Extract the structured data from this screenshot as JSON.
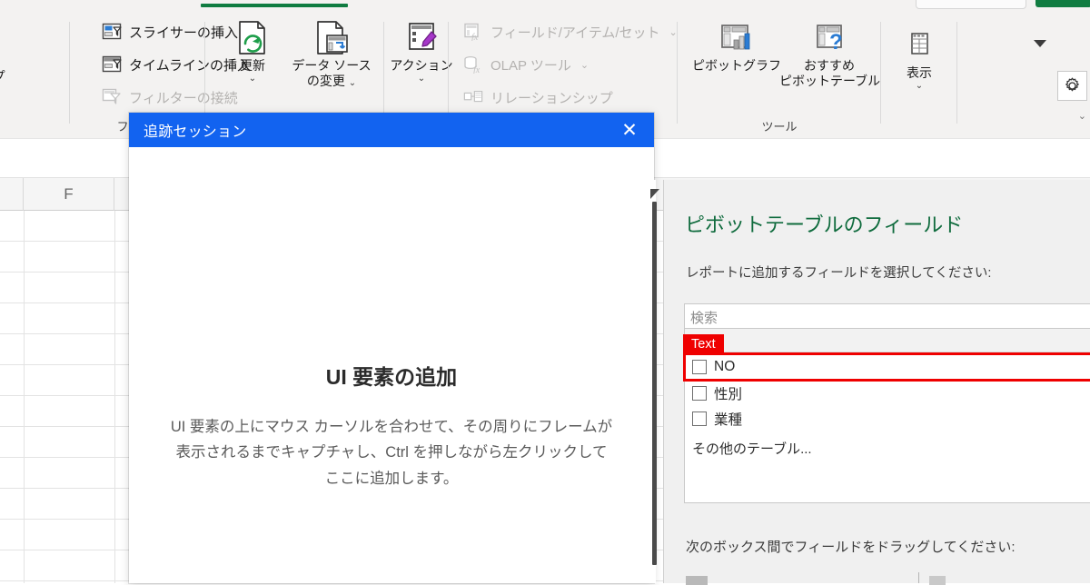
{
  "ribbon": {
    "groups": [
      {
        "label": "",
        "name": "group-partial"
      },
      {
        "label": "フィルター",
        "name": "group-filter"
      },
      {
        "label": "",
        "name": "group-data"
      },
      {
        "label": "",
        "name": "group-calculations"
      },
      {
        "label": "ツール",
        "name": "group-tools"
      },
      {
        "label": "",
        "name": "group-show"
      }
    ],
    "left_partial": {
      "caption": "ープ",
      "chevron": "⌄"
    },
    "filter_items": [
      {
        "label": "スライサーの挿入",
        "icon": "insert-slicer-icon",
        "disabled": false
      },
      {
        "label": "タイムラインの挿入",
        "icon": "insert-timeline-icon",
        "disabled": false
      },
      {
        "label": "フィルターの接続",
        "icon": "filter-connections-icon",
        "disabled": true
      }
    ],
    "refresh_button": {
      "label": "更新",
      "chevron": "⌄",
      "icon": "refresh-icon"
    },
    "change_source_button": {
      "label_line1": "データ ソース",
      "label_line2": "の変更",
      "chevron": "⌄",
      "icon": "change-data-source-icon"
    },
    "actions_button": {
      "label": "アクション",
      "chevron": "⌄",
      "icon": "actions-icon"
    },
    "calc_items": [
      {
        "label": "フィールド/アイテム/セット",
        "icon": "fields-items-sets-icon",
        "dropdown": "⌄",
        "disabled": true
      },
      {
        "label": "OLAP ツール",
        "icon": "olap-tools-icon",
        "dropdown": "⌄",
        "disabled": true
      },
      {
        "label": "リレーションシップ",
        "icon": "relationships-icon",
        "dropdown": "",
        "disabled": true
      }
    ],
    "pivotchart_button": {
      "label": "ピボットグラフ",
      "icon": "pivotchart-icon"
    },
    "recommended_button": {
      "label_line1": "おすすめ",
      "label_line2": "ピボットテーブル",
      "icon": "recommended-pivottable-icon"
    },
    "show_button": {
      "label": "表示",
      "chevron": "⌄",
      "icon": "show-icon"
    },
    "accent_green": "#107c41"
  },
  "sheet": {
    "column_header": "F",
    "columns": [
      "",
      "F",
      ""
    ]
  },
  "dialog": {
    "title": "追跡セッション",
    "close_glyph": "✕",
    "heading": "UI 要素の追加",
    "body": "UI 要素の上にマウス カーソルを合わせて、その周りにフレームが表示されるまでキャプチャし、Ctrl を押しながら左クリックしてここに追加します。",
    "title_bar_color": "#1263f0"
  },
  "panel": {
    "title": "ピボットテーブルのフィールド",
    "title_color": "#0f6b3d",
    "subtitle": "レポートに追加するフィールドを選択してください:",
    "gear_icon": "gear-icon",
    "caret_icon": "chevron-down-icon",
    "search_placeholder": "検索",
    "table_header": "",
    "fields": [
      {
        "label": "NO",
        "checked": false,
        "highlighted": true
      },
      {
        "label": "性別",
        "checked": false,
        "highlighted": false
      },
      {
        "label": "業種",
        "checked": false,
        "highlighted": false
      }
    ],
    "more_tables": "その他のテーブル...",
    "drag_label": "次のボックス間でフィールドをドラッグしてください:"
  },
  "annotation": {
    "tag_text": "Text",
    "tag_color": "#ef0000",
    "box_color": "#ef0000"
  }
}
